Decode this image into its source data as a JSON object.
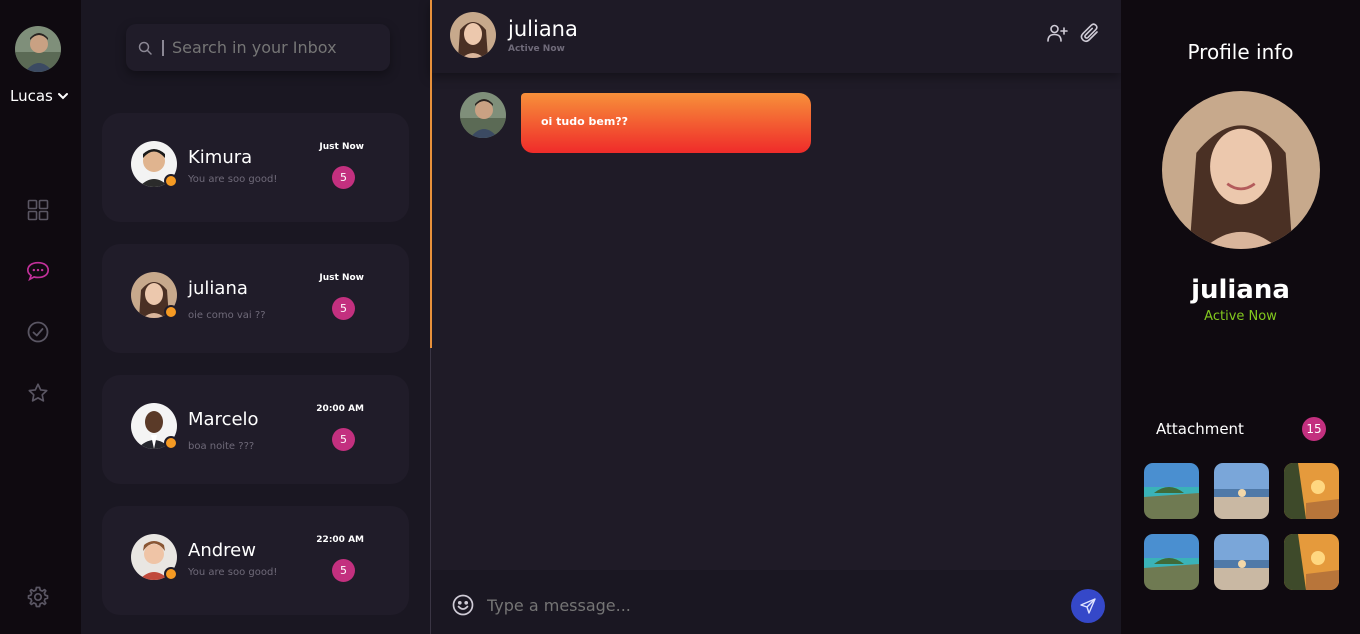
{
  "user": {
    "name": "Lucas"
  },
  "search": {
    "placeholder": "Search in your Inbox"
  },
  "conversations": [
    {
      "name": "Kimura",
      "preview": "You are soo good!",
      "time": "Just Now",
      "unread": "5"
    },
    {
      "name": "juliana",
      "preview": "oie como vai ??",
      "time": "Just Now",
      "unread": "5"
    },
    {
      "name": "Marcelo",
      "preview": "boa noite ???",
      "time": "20:00 AM",
      "unread": "5"
    },
    {
      "name": "Andrew",
      "preview": "You are soo good!",
      "time": "22:00 AM",
      "unread": "5"
    }
  ],
  "chat": {
    "contact_name": "juliana",
    "contact_status": "Active Now",
    "messages": [
      {
        "text": "oi tudo bem??"
      }
    ],
    "composer_placeholder": "Type a message..."
  },
  "profile": {
    "title": "Profile info",
    "name": "juliana",
    "status": "Active Now",
    "attachments_label": "Attachment",
    "attachments_count": "15"
  },
  "colors": {
    "accent_pink": "#c3307f",
    "online_dot": "#f59a23",
    "active_green": "#82c91e",
    "send_button": "#3548c9",
    "bubble_top": "#f7903a",
    "bubble_bottom": "#ef2b2a"
  }
}
